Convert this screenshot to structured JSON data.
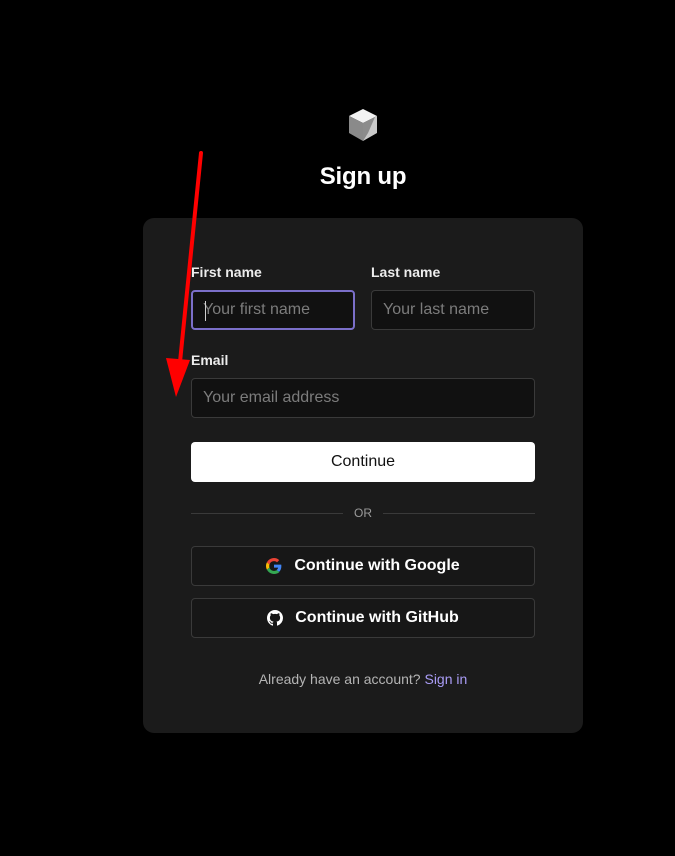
{
  "header": {
    "logo_icon": "cube-logo-icon",
    "title": "Sign up"
  },
  "form": {
    "first_name": {
      "label": "First name",
      "placeholder": "Your first name",
      "value": "",
      "focused": true
    },
    "last_name": {
      "label": "Last name",
      "placeholder": "Your last name",
      "value": ""
    },
    "email": {
      "label": "Email",
      "placeholder": "Your email address",
      "value": ""
    },
    "continue_label": "Continue"
  },
  "divider": {
    "text": "OR"
  },
  "oauth": {
    "google": {
      "label": "Continue with Google",
      "icon": "google-icon"
    },
    "github": {
      "label": "Continue with GitHub",
      "icon": "github-icon"
    }
  },
  "footer": {
    "prompt": "Already have an account?",
    "link": "Sign in"
  },
  "annotation": {
    "type": "red-arrow",
    "color": "#ff0000"
  },
  "colors": {
    "background": "#000000",
    "card": "#1b1b1b",
    "focus_border": "#7b6fc9",
    "link": "#a99cf5"
  }
}
